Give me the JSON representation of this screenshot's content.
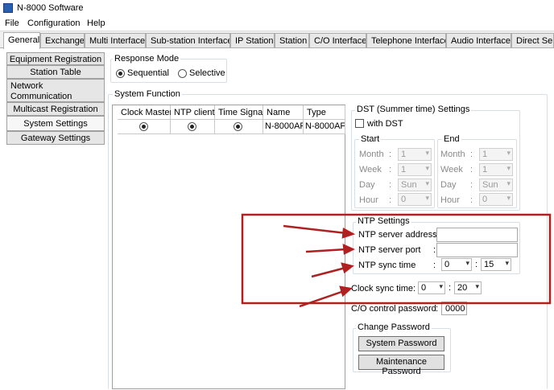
{
  "window": {
    "title": "N-8000 Software"
  },
  "menu": [
    "File",
    "Configuration",
    "Help"
  ],
  "tabs": [
    "General",
    "Exchange",
    "Multi Interface",
    "Sub-station Interface",
    "IP Station",
    "Station",
    "C/O Interface",
    "Telephone Interface",
    "Audio Interface",
    "Direct Sele"
  ],
  "nav": [
    "Equipment Registration",
    "Station Table",
    "Network Communication Registration",
    "Multicast Registration",
    "System Settings",
    "Gateway Settings"
  ],
  "response_mode": {
    "title": "Response Mode",
    "options": [
      "Sequential",
      "Selective"
    ],
    "selected": "Sequential"
  },
  "system_function": {
    "title": "System Function",
    "columns": [
      "Clock Master",
      "NTP client",
      "Time Signal",
      "Name",
      "Type"
    ],
    "rows": [
      {
        "name": "N-8000AF",
        "type": "N-8000AF"
      }
    ]
  },
  "dst": {
    "title": "DST (Summer time) Settings",
    "checkbox": "with DST",
    "start": {
      "title": "Start",
      "month": "1",
      "week": "1",
      "day": "Sun",
      "hour": "0"
    },
    "end": {
      "title": "End",
      "month": "1",
      "week": "1",
      "day": "Sun",
      "hour": "0"
    },
    "labels": {
      "month": "Month",
      "week": "Week",
      "day": "Day",
      "hour": "Hour"
    },
    "colon": ":"
  },
  "ntp": {
    "title": "NTP Settings",
    "server_address_label": "NTP server address",
    "server_address_value": "",
    "server_port_label": "NTP server port",
    "server_port_value": "",
    "sync_time_label": "NTP sync time",
    "sync_hour": "0",
    "sync_minute": "15",
    "colon": ":"
  },
  "clock_sync": {
    "label": "Clock sync time",
    "hour": "0",
    "minute": "20",
    "colon": ":"
  },
  "co_password": {
    "label": "C/O control password",
    "value": "0000",
    "colon": ":"
  },
  "change_password": {
    "title": "Change Password",
    "system_button": "System Password",
    "maintenance_button": "Maintenance Password"
  },
  "annotation_color": "#b02020",
  "accent_color": "#2a5fb0"
}
